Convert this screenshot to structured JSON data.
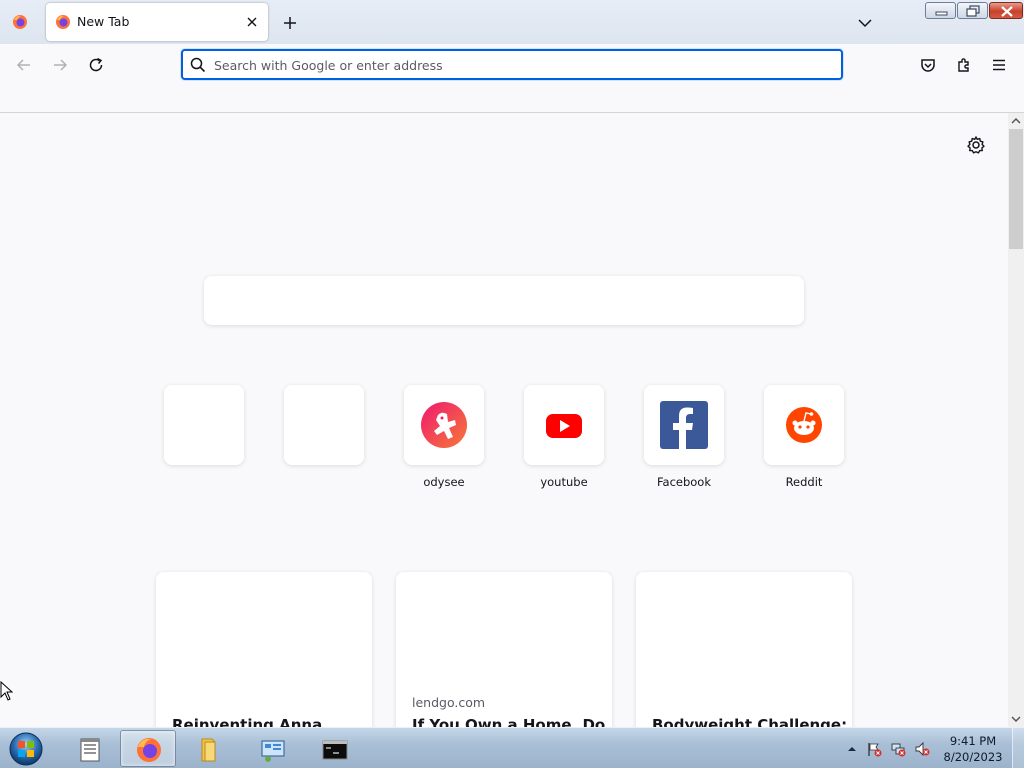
{
  "browser": {
    "tab": {
      "title": "New Tab"
    },
    "urlbar": {
      "placeholder": "Search with Google or enter address",
      "value": ""
    }
  },
  "newtab": {
    "top_sites": [
      {
        "label": "",
        "icon": "empty"
      },
      {
        "label": "",
        "icon": "empty"
      },
      {
        "label": "odysee",
        "icon": "odysee-icon"
      },
      {
        "label": "youtube",
        "icon": "youtube-icon"
      },
      {
        "label": "Facebook",
        "icon": "facebook-icon"
      },
      {
        "label": "Reddit",
        "icon": "reddit-icon"
      }
    ],
    "stories": [
      {
        "source": "",
        "title": "Reinventing Anna"
      },
      {
        "source": "lendgo.com",
        "title": "If You Own a Home, Do"
      },
      {
        "source": "",
        "title": "Bodyweight Challenge:"
      }
    ]
  },
  "taskbar": {
    "clock": {
      "time": "9:41 PM",
      "date": "8/20/2023"
    }
  },
  "colors": {
    "accent": "#0061e0",
    "youtube": "#ff0000",
    "facebook": "#3b5998",
    "reddit": "#ff4500",
    "odysee": "#e50054"
  }
}
